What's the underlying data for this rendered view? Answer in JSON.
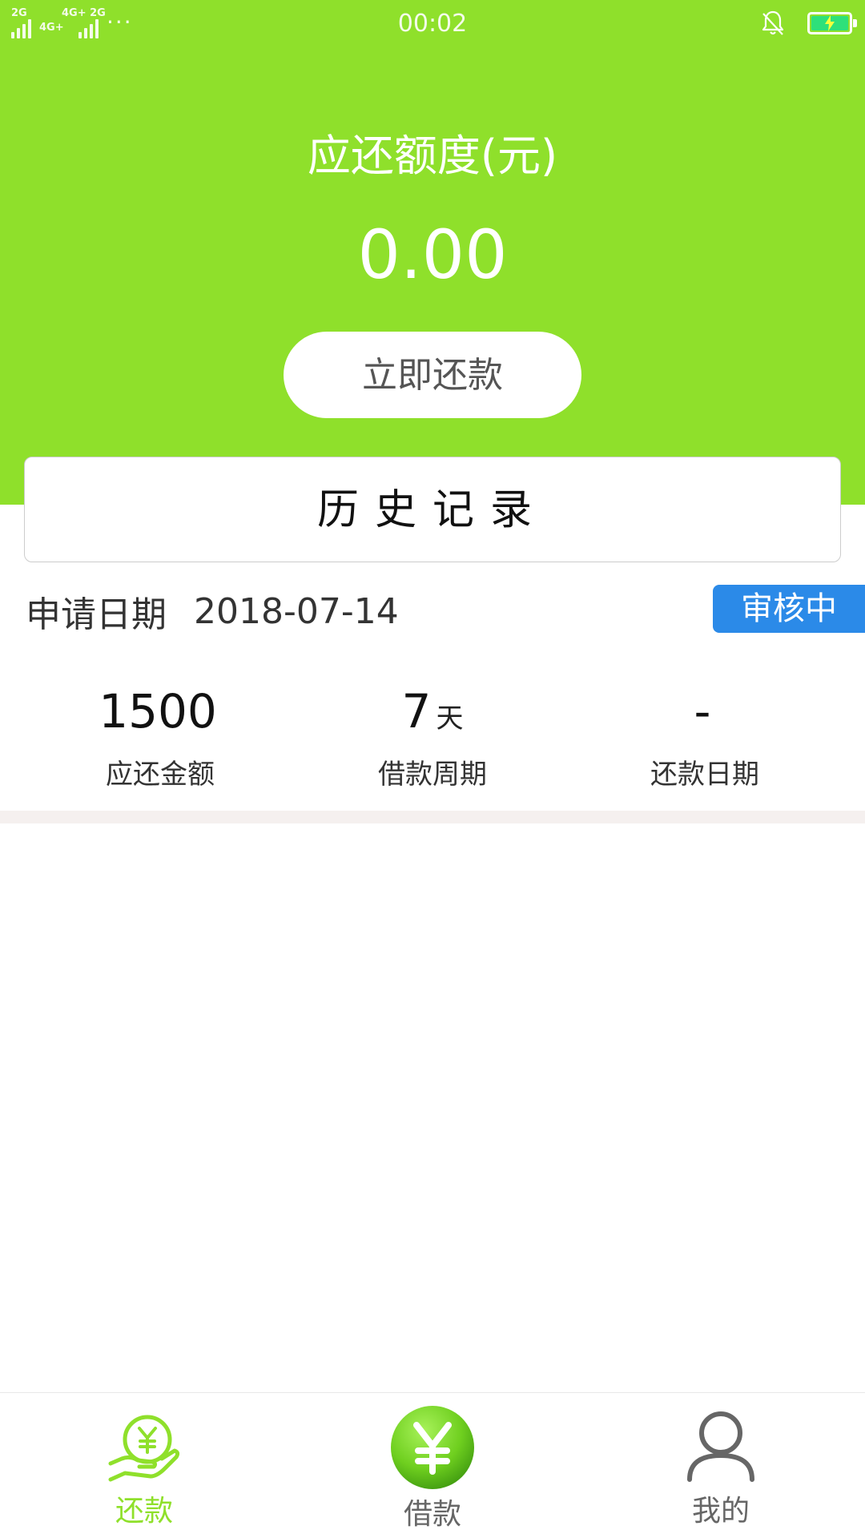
{
  "status_bar": {
    "signal1_label": "2G",
    "signal2_label": "4G+",
    "signal3_label": "4G+ 2G",
    "more": "···",
    "time": "00:02",
    "battery_level": 1.0,
    "battery_fill_color": "#2ee07a"
  },
  "header": {
    "title": "应还额度(元)",
    "amount": "0.00",
    "repay_button_label": "立即还款",
    "background_color": "#8fe02b"
  },
  "history": {
    "label": "历史记录"
  },
  "application": {
    "date_label": "申请日期",
    "date_value": "2018-07-14",
    "status_label": "审核中",
    "status_color": "#2b8ae8"
  },
  "stats": [
    {
      "value": "1500",
      "unit": "",
      "label": "应还金额"
    },
    {
      "value": "7",
      "unit": "天",
      "label": "借款周期"
    },
    {
      "value": "-",
      "unit": "",
      "label": "还款日期"
    }
  ],
  "bottom_nav": {
    "items": [
      {
        "label": "还款",
        "icon": "repay-hand-icon",
        "active": true
      },
      {
        "label": "借款",
        "icon": "yuan-coin-icon",
        "active": false
      },
      {
        "label": "我的",
        "icon": "user-icon",
        "active": false
      }
    ],
    "active_color": "#8fe02b",
    "inactive_color": "#666666"
  }
}
